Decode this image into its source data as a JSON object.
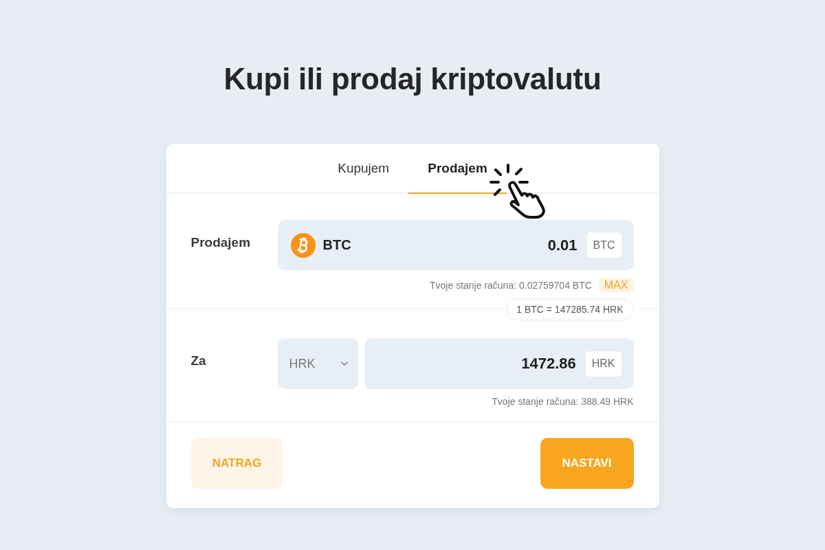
{
  "page": {
    "title": "Kupi ili prodaj kriptovalutu"
  },
  "tabs": [
    {
      "label": "Kupujem",
      "selected": false
    },
    {
      "label": "Prodajem",
      "selected": true
    }
  ],
  "sell": {
    "label": "Prodajem",
    "currency": "BTC",
    "amount": "0.01",
    "unit": "BTC",
    "balance": "Tvoje stanje računa: 0.02759704 BTC",
    "max_button": "MAX"
  },
  "rate": "1 BTC = 147285.74 HRK",
  "receive": {
    "label": "Za",
    "currency_select": "HRK",
    "amount": "1472.86",
    "unit": "HRK",
    "balance": "Tvoje stanje računa: 388.49 HRK"
  },
  "buttons": [
    {
      "label": "NATRAG",
      "kind": "secondary"
    },
    {
      "label": "NASTAVI",
      "kind": "primary"
    }
  ]
}
